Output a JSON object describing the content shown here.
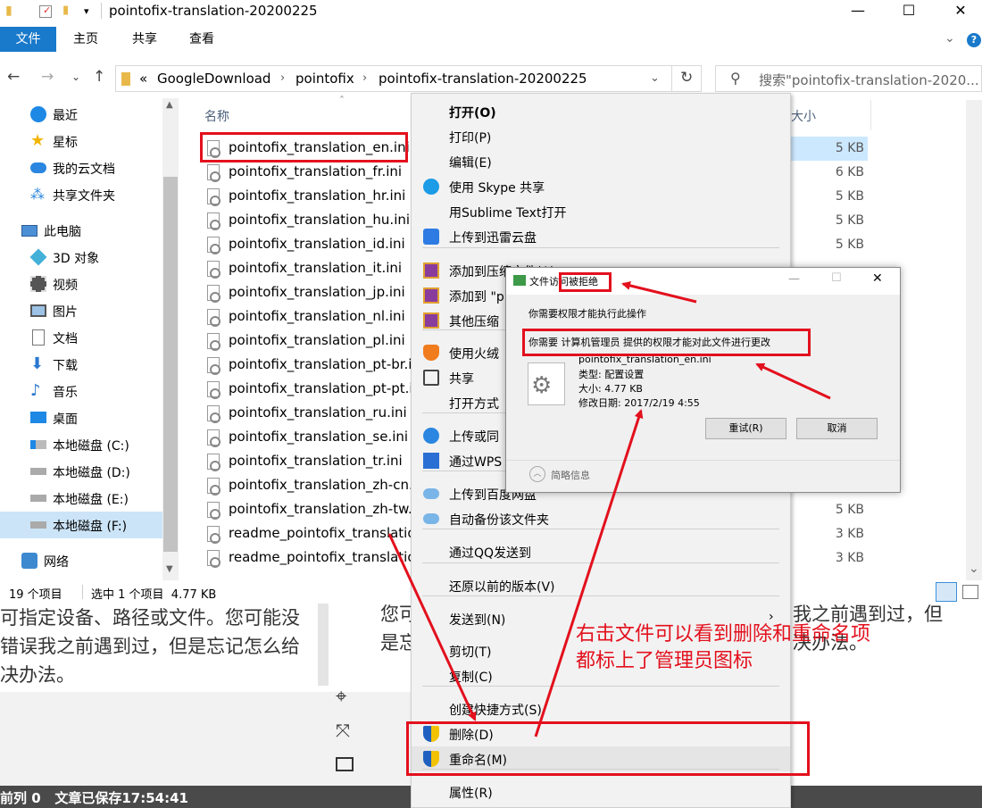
{
  "window": {
    "title": "pointofix-translation-20200225",
    "minimize": "—",
    "maximize": "☐",
    "close": "✕"
  },
  "ribbon": {
    "tabs": [
      "文件",
      "主页",
      "共享",
      "查看"
    ],
    "help": "?"
  },
  "address": {
    "crumbs": [
      "«",
      "GoogleDownload",
      "pointofix",
      "pointofix-translation-20200225"
    ],
    "search_placeholder": "搜索\"pointofix-translation-2020..."
  },
  "nav": {
    "items": [
      {
        "label": "最近",
        "icon": "clock-icon"
      },
      {
        "label": "星标",
        "icon": "star-icon"
      },
      {
        "label": "我的云文档",
        "icon": "cloud-icon"
      },
      {
        "label": "共享文件夹",
        "icon": "shared-folder-icon"
      },
      {
        "label": "此电脑",
        "icon": "computer-icon"
      },
      {
        "label": "3D 对象",
        "icon": "cube-icon"
      },
      {
        "label": "视频",
        "icon": "video-icon"
      },
      {
        "label": "图片",
        "icon": "picture-icon"
      },
      {
        "label": "文档",
        "icon": "document-icon"
      },
      {
        "label": "下载",
        "icon": "download-icon"
      },
      {
        "label": "音乐",
        "icon": "music-icon"
      },
      {
        "label": "桌面",
        "icon": "desktop-icon"
      },
      {
        "label": "本地磁盘 (C:)",
        "icon": "drive-icon"
      },
      {
        "label": "本地磁盘 (D:)",
        "icon": "drive-icon"
      },
      {
        "label": "本地磁盘 (E:)",
        "icon": "drive-icon"
      },
      {
        "label": "本地磁盘 (F:)",
        "icon": "drive-icon"
      },
      {
        "label": "网络",
        "icon": "network-icon"
      }
    ]
  },
  "files": {
    "column_name": "名称",
    "column_size": "大小",
    "rows": [
      {
        "name": "pointofix_translation_en.ini",
        "size": "5 KB"
      },
      {
        "name": "pointofix_translation_fr.ini",
        "size": "6 KB"
      },
      {
        "name": "pointofix_translation_hr.ini",
        "size": "5 KB"
      },
      {
        "name": "pointofix_translation_hu.ini",
        "size": "5 KB"
      },
      {
        "name": "pointofix_translation_id.ini",
        "size": "5 KB"
      },
      {
        "name": "pointofix_translation_it.ini",
        "size": ""
      },
      {
        "name": "pointofix_translation_jp.ini",
        "size": ""
      },
      {
        "name": "pointofix_translation_nl.ini",
        "size": ""
      },
      {
        "name": "pointofix_translation_pl.ini",
        "size": ""
      },
      {
        "name": "pointofix_translation_pt-br.i",
        "size": ""
      },
      {
        "name": "pointofix_translation_pt-pt.i",
        "size": ""
      },
      {
        "name": "pointofix_translation_ru.ini",
        "size": ""
      },
      {
        "name": "pointofix_translation_se.ini",
        "size": ""
      },
      {
        "name": "pointofix_translation_tr.ini",
        "size": ""
      },
      {
        "name": "pointofix_translation_zh-cn.i",
        "size": ""
      },
      {
        "name": "pointofix_translation_zh-tw.i",
        "size": "5 KB"
      },
      {
        "name": "readme_pointofix_translatio",
        "size": "3 KB"
      },
      {
        "name": "readme_pointofix_translatio",
        "size": "3 KB"
      }
    ]
  },
  "status": {
    "count": "19 个项目",
    "selected": "选中 1 个项目  4.77 KB"
  },
  "context_menu": {
    "items": [
      {
        "label": "打开(O)",
        "bold": true,
        "icon": ""
      },
      {
        "label": "打印(P)",
        "icon": ""
      },
      {
        "label": "编辑(E)",
        "icon": ""
      },
      {
        "label": "使用 Skype 共享",
        "icon": "skype-icon"
      },
      {
        "label": "用Sublime Text打开",
        "icon": ""
      },
      {
        "label": "上传到迅雷云盘",
        "icon": "thunder-icon"
      },
      {
        "label": "添加到压缩文件(A)...",
        "icon": "archive-icon"
      },
      {
        "label": "添加到 \"p",
        "icon": "archive-icon"
      },
      {
        "label": "其他压缩",
        "icon": "archive-icon"
      },
      {
        "label": "使用火绒",
        "icon": "huorong-icon"
      },
      {
        "label": "共享",
        "icon": "share-icon"
      },
      {
        "label": "打开方式",
        "icon": ""
      },
      {
        "label": "上传或同",
        "icon": "upload-icon"
      },
      {
        "label": "通过WPS",
        "icon": "wps-icon"
      },
      {
        "label": "上传到百度网盘",
        "icon": "baidu-icon"
      },
      {
        "label": "自动备份该文件夹",
        "icon": "baidu-icon"
      },
      {
        "label": "通过QQ发送到",
        "icon": ""
      },
      {
        "label": "还原以前的版本(V)",
        "icon": ""
      },
      {
        "label": "发送到(N)",
        "icon": ""
      },
      {
        "label": "剪切(T)",
        "icon": ""
      },
      {
        "label": "复制(C)",
        "icon": ""
      },
      {
        "label": "创建快捷方式(S)",
        "icon": ""
      },
      {
        "label": "删除(D)",
        "icon": "uac-shield-icon"
      },
      {
        "label": "重命名(M)",
        "icon": "uac-shield-icon"
      },
      {
        "label": "属性(R)",
        "icon": ""
      }
    ]
  },
  "dialog": {
    "title": "文件访问被拒绝",
    "message": "你需要权限才能执行此操作",
    "detail": "你需要 计算机管理员 提供的权限才能对此文件进行更改",
    "file_name": "pointofix_translation_en.ini",
    "file_type": "类型: 配置设置",
    "file_size": "大小: 4.77 KB",
    "file_date": "修改日期: 2017/2/19 4:55",
    "retry": "重试(R)",
    "cancel": "取消",
    "more_info": "简略信息"
  },
  "background": {
    "left_lines": [
      "可指定设备、路径或文件。您可能没",
      "错误我之前遇到过，但是忘记怎么给",
      "决办法。"
    ],
    "right_line1_a": "您可",
    "right_line1_b": "我之前遇到过，但",
    "right_line2_a": "是忘",
    "right_line2_b": "决办法。"
  },
  "bottom_bar": {
    "text": "前列 0   文章已保存17:54:41"
  },
  "annotation": {
    "line1": "右击文件可以看到删除和重命名项",
    "line2": "都标上了管理员图标",
    "color": "#e3101d"
  }
}
